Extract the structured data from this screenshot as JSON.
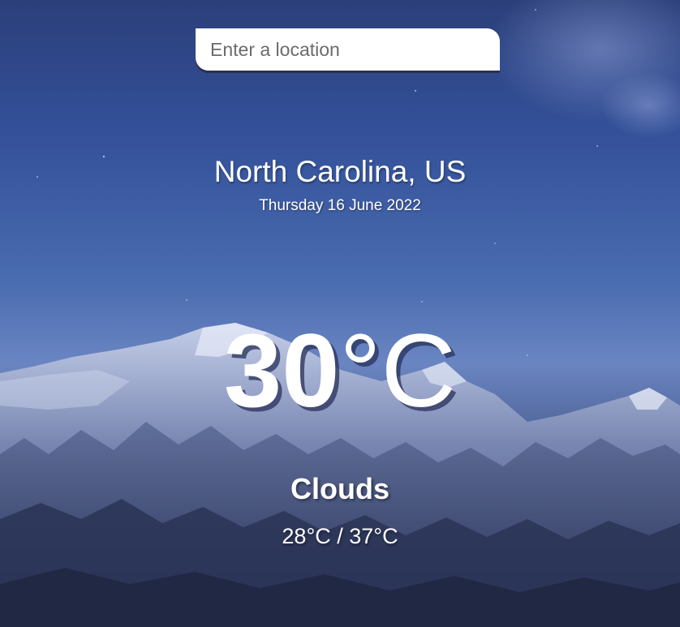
{
  "search": {
    "placeholder": "Enter a location",
    "value": ""
  },
  "location": {
    "name": "North Carolina, US",
    "date": "Thursday 16 June 2022"
  },
  "weather": {
    "temperature_value": "30",
    "temperature_unit": "°C",
    "condition": "Clouds",
    "range": "28°C / 37°C"
  },
  "colors": {
    "text": "#ffffff",
    "sky_top": "#2b3f7a",
    "sky_mid": "#6a85c2",
    "mountain_dark": "#2f3c63"
  }
}
